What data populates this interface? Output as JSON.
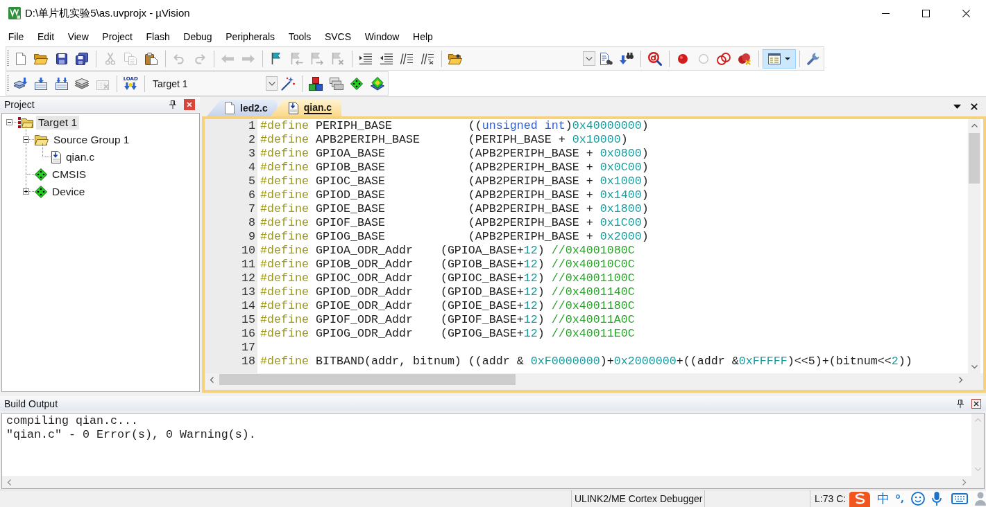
{
  "window": {
    "title": "D:\\单片机实验5\\as.uvprojx - µVision"
  },
  "menu": [
    "File",
    "Edit",
    "View",
    "Project",
    "Flash",
    "Debug",
    "Peripherals",
    "Tools",
    "SVCS",
    "Window",
    "Help"
  ],
  "toolbar_1": {
    "groups": [
      {
        "buttons": [
          {
            "kind": "button",
            "disabled": false,
            "on": false
          },
          {
            "kind": "button",
            "disabled": false,
            "on": false
          },
          {
            "kind": "button",
            "disabled": false,
            "on": false
          },
          {
            "kind": "button",
            "disabled": false,
            "on": false
          }
        ]
      },
      {
        "buttons": [
          {
            "kind": "button",
            "disabled": true,
            "on": false
          },
          {
            "kind": "button",
            "disabled": true,
            "on": false
          },
          {
            "kind": "button",
            "disabled": false,
            "on": false
          }
        ]
      },
      {
        "buttons": [
          {
            "kind": "button",
            "disabled": true,
            "on": false
          },
          {
            "kind": "button",
            "disabled": true,
            "on": false
          }
        ]
      },
      {
        "buttons": [
          {
            "kind": "button",
            "disabled": true,
            "on": false
          },
          {
            "kind": "button",
            "disabled": true,
            "on": false
          }
        ]
      },
      {
        "buttons": [
          {
            "kind": "button",
            "disabled": false,
            "on": false
          },
          {
            "kind": "button",
            "disabled": true,
            "on": false
          },
          {
            "kind": "button",
            "disabled": true,
            "on": false
          },
          {
            "kind": "button",
            "disabled": true,
            "on": false
          }
        ]
      },
      {
        "buttons": [
          {
            "kind": "button",
            "disabled": false,
            "on": false
          },
          {
            "kind": "button",
            "disabled": false,
            "on": false
          },
          {
            "kind": "button",
            "disabled": false,
            "on": false
          },
          {
            "kind": "button",
            "disabled": false,
            "on": false
          }
        ]
      },
      {
        "buttons": [
          {
            "kind": "button",
            "disabled": false,
            "on": false
          }
        ]
      },
      {
        "buttons": [
          {
            "kind": "dropdown",
            "disabled": false,
            "on": false
          },
          {
            "kind": "button",
            "disabled": false,
            "on": false
          },
          {
            "kind": "button",
            "disabled": false,
            "on": false
          }
        ]
      },
      {
        "buttons": [
          {
            "kind": "button",
            "disabled": false,
            "on": false
          }
        ]
      },
      {
        "buttons": [
          {
            "kind": "button",
            "disabled": false,
            "on": false
          },
          {
            "kind": "button",
            "disabled": true,
            "on": false
          },
          {
            "kind": "button",
            "disabled": false,
            "on": false
          },
          {
            "kind": "button",
            "disabled": false,
            "on": false
          }
        ]
      },
      {
        "buttons": [
          {
            "kind": "split",
            "disabled": false,
            "on": true
          }
        ]
      },
      {
        "buttons": [
          {
            "kind": "button",
            "disabled": false,
            "on": false
          }
        ]
      }
    ]
  },
  "toolbar_2": {
    "groups": [
      {
        "buttons": [
          {
            "kind": "button",
            "disabled": false,
            "on": false
          },
          {
            "kind": "button",
            "disabled": false,
            "on": false
          },
          {
            "kind": "button",
            "disabled": false,
            "on": false
          },
          {
            "kind": "button",
            "disabled": false,
            "on": false
          },
          {
            "kind": "button",
            "disabled": true,
            "on": false
          }
        ]
      },
      {
        "buttons": [
          {
            "kind": "load",
            "label": "LOAD",
            "disabled": false,
            "on": false
          }
        ]
      },
      {
        "buttons": [
          {
            "kind": "select",
            "value": "Target 1"
          },
          {
            "kind": "button",
            "disabled": false,
            "on": false
          }
        ]
      },
      {
        "buttons": [
          {
            "kind": "button",
            "disabled": false,
            "on": false
          },
          {
            "kind": "button",
            "disabled": false,
            "on": false
          },
          {
            "kind": "button",
            "disabled": false,
            "on": false
          },
          {
            "kind": "button",
            "disabled": false,
            "on": false
          }
        ]
      }
    ]
  },
  "project_panel": {
    "title": "Project",
    "tree": [
      {
        "label": "Target 1",
        "kind": "target",
        "selected": true,
        "expanded": true,
        "children": [
          {
            "label": "Source Group 1",
            "kind": "group",
            "selected": false,
            "expanded": true,
            "children": [
              {
                "label": "qian.c",
                "kind": "file",
                "selected": false
              }
            ]
          },
          {
            "label": "CMSIS",
            "kind": "component",
            "selected": false
          },
          {
            "label": "Device",
            "kind": "component",
            "selected": false,
            "expanded": false
          }
        ]
      }
    ]
  },
  "editor": {
    "tabs": [
      {
        "label": "led2.c",
        "kind": "document",
        "selected": false
      },
      {
        "label": "qian.c",
        "kind": "file",
        "selected": true
      }
    ],
    "lines": [
      {
        "number": "1",
        "tokens": [
          {
            "kind": "directive",
            "text": "#define"
          },
          {
            "kind": "plain",
            "text": " PERIPH_BASE           (("
          },
          {
            "kind": "keyword",
            "text": "unsigned int"
          },
          {
            "kind": "plain",
            "text": ")"
          },
          {
            "kind": "number",
            "text": "0x40000000"
          },
          {
            "kind": "plain",
            "text": ")"
          }
        ]
      },
      {
        "number": "2",
        "tokens": [
          {
            "kind": "directive",
            "text": "#define"
          },
          {
            "kind": "plain",
            "text": " APB2PERIPH_BASE       (PERIPH_BASE + "
          },
          {
            "kind": "number",
            "text": "0x10000"
          },
          {
            "kind": "plain",
            "text": ")"
          }
        ]
      },
      {
        "number": "3",
        "tokens": [
          {
            "kind": "directive",
            "text": "#define"
          },
          {
            "kind": "plain",
            "text": " GPIOA_BASE            (APB2PERIPH_BASE + "
          },
          {
            "kind": "number",
            "text": "0x0800"
          },
          {
            "kind": "plain",
            "text": ")"
          }
        ]
      },
      {
        "number": "4",
        "tokens": [
          {
            "kind": "directive",
            "text": "#define"
          },
          {
            "kind": "plain",
            "text": " GPIOB_BASE            (APB2PERIPH_BASE + "
          },
          {
            "kind": "number",
            "text": "0x0C00"
          },
          {
            "kind": "plain",
            "text": ")"
          }
        ]
      },
      {
        "number": "5",
        "tokens": [
          {
            "kind": "directive",
            "text": "#define"
          },
          {
            "kind": "plain",
            "text": " GPIOC_BASE            (APB2PERIPH_BASE + "
          },
          {
            "kind": "number",
            "text": "0x1000"
          },
          {
            "kind": "plain",
            "text": ")"
          }
        ]
      },
      {
        "number": "6",
        "tokens": [
          {
            "kind": "directive",
            "text": "#define"
          },
          {
            "kind": "plain",
            "text": " GPIOD_BASE            (APB2PERIPH_BASE + "
          },
          {
            "kind": "number",
            "text": "0x1400"
          },
          {
            "kind": "plain",
            "text": ")"
          }
        ]
      },
      {
        "number": "7",
        "tokens": [
          {
            "kind": "directive",
            "text": "#define"
          },
          {
            "kind": "plain",
            "text": " GPIOE_BASE            (APB2PERIPH_BASE + "
          },
          {
            "kind": "number",
            "text": "0x1800"
          },
          {
            "kind": "plain",
            "text": ")"
          }
        ]
      },
      {
        "number": "8",
        "tokens": [
          {
            "kind": "directive",
            "text": "#define"
          },
          {
            "kind": "plain",
            "text": " GPIOF_BASE            (APB2PERIPH_BASE + "
          },
          {
            "kind": "number",
            "text": "0x1C00"
          },
          {
            "kind": "plain",
            "text": ")"
          }
        ]
      },
      {
        "number": "9",
        "tokens": [
          {
            "kind": "directive",
            "text": "#define"
          },
          {
            "kind": "plain",
            "text": " GPIOG_BASE            (APB2PERIPH_BASE + "
          },
          {
            "kind": "number",
            "text": "0x2000"
          },
          {
            "kind": "plain",
            "text": ")"
          }
        ]
      },
      {
        "number": "10",
        "tokens": [
          {
            "kind": "directive",
            "text": "#define"
          },
          {
            "kind": "plain",
            "text": " GPIOA_ODR_Addr    (GPIOA_BASE+"
          },
          {
            "kind": "number",
            "text": "12"
          },
          {
            "kind": "plain",
            "text": ") "
          },
          {
            "kind": "comment",
            "text": "//0x4001080C"
          }
        ]
      },
      {
        "number": "11",
        "tokens": [
          {
            "kind": "directive",
            "text": "#define"
          },
          {
            "kind": "plain",
            "text": " GPIOB_ODR_Addr    (GPIOB_BASE+"
          },
          {
            "kind": "number",
            "text": "12"
          },
          {
            "kind": "plain",
            "text": ") "
          },
          {
            "kind": "comment",
            "text": "//0x40010C0C"
          }
        ]
      },
      {
        "number": "12",
        "tokens": [
          {
            "kind": "directive",
            "text": "#define"
          },
          {
            "kind": "plain",
            "text": " GPIOC_ODR_Addr    (GPIOC_BASE+"
          },
          {
            "kind": "number",
            "text": "12"
          },
          {
            "kind": "plain",
            "text": ") "
          },
          {
            "kind": "comment",
            "text": "//0x4001100C"
          }
        ]
      },
      {
        "number": "13",
        "tokens": [
          {
            "kind": "directive",
            "text": "#define"
          },
          {
            "kind": "plain",
            "text": " GPIOD_ODR_Addr    (GPIOD_BASE+"
          },
          {
            "kind": "number",
            "text": "12"
          },
          {
            "kind": "plain",
            "text": ") "
          },
          {
            "kind": "comment",
            "text": "//0x4001140C"
          }
        ]
      },
      {
        "number": "14",
        "tokens": [
          {
            "kind": "directive",
            "text": "#define"
          },
          {
            "kind": "plain",
            "text": " GPIOE_ODR_Addr    (GPIOE_BASE+"
          },
          {
            "kind": "number",
            "text": "12"
          },
          {
            "kind": "plain",
            "text": ") "
          },
          {
            "kind": "comment",
            "text": "//0x4001180C"
          }
        ]
      },
      {
        "number": "15",
        "tokens": [
          {
            "kind": "directive",
            "text": "#define"
          },
          {
            "kind": "plain",
            "text": " GPIOF_ODR_Addr    (GPIOF_BASE+"
          },
          {
            "kind": "number",
            "text": "12"
          },
          {
            "kind": "plain",
            "text": ") "
          },
          {
            "kind": "comment",
            "text": "//0x40011A0C"
          }
        ]
      },
      {
        "number": "16",
        "tokens": [
          {
            "kind": "directive",
            "text": "#define"
          },
          {
            "kind": "plain",
            "text": " GPIOG_ODR_Addr    (GPIOG_BASE+"
          },
          {
            "kind": "number",
            "text": "12"
          },
          {
            "kind": "plain",
            "text": ") "
          },
          {
            "kind": "comment",
            "text": "//0x40011E0C"
          }
        ]
      },
      {
        "number": "17"
      },
      {
        "number": "18",
        "tokens": [
          {
            "kind": "directive",
            "text": "#define"
          },
          {
            "kind": "plain",
            "text": " BITBAND(addr, bitnum) ((addr & "
          },
          {
            "kind": "number",
            "text": "0xF0000000"
          },
          {
            "kind": "plain",
            "text": ")+"
          },
          {
            "kind": "number",
            "text": "0x2000000"
          },
          {
            "kind": "plain",
            "text": "+((addr &"
          },
          {
            "kind": "number",
            "text": "0xFFFFF"
          },
          {
            "kind": "plain",
            "text": ")<<5)+(bitnum<<"
          },
          {
            "kind": "number",
            "text": "2"
          },
          {
            "kind": "plain",
            "text": "))"
          }
        ]
      }
    ]
  },
  "build_output": {
    "title": "Build Output",
    "lines": [
      "compiling qian.c...",
      "\"qian.c\" - 0 Error(s), 0 Warning(s)."
    ]
  },
  "status_bar": {
    "debugger": "ULINK2/ME Cortex Debugger",
    "position": "L:73 C:"
  },
  "ime_toolbar": {
    "mode": "中"
  }
}
